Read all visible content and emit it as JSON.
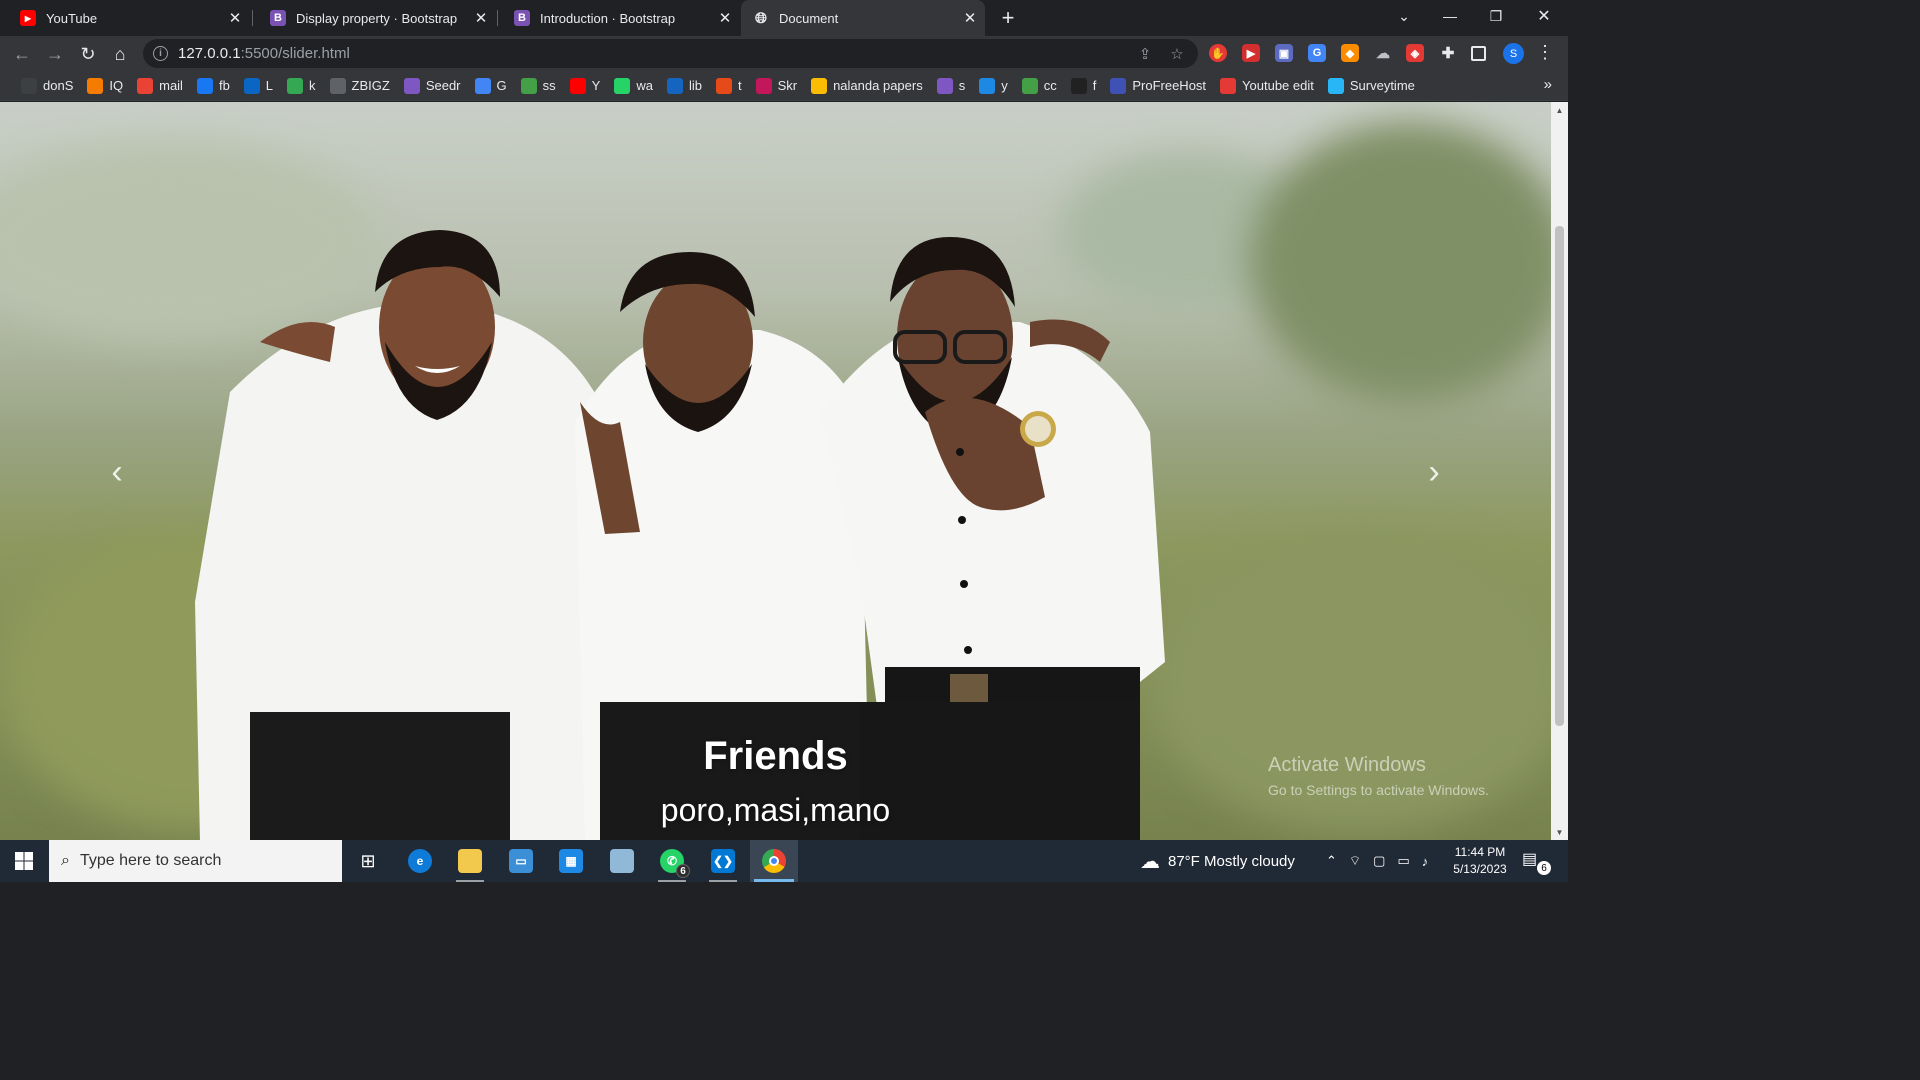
{
  "browser": {
    "tabs": [
      {
        "title": "YouTube",
        "favicon": "youtube-icon",
        "active": false
      },
      {
        "title": "Display property · Bootstrap",
        "favicon": "bootstrap-icon",
        "active": false
      },
      {
        "title": "Introduction · Bootstrap",
        "favicon": "bootstrap-icon",
        "active": false
      },
      {
        "title": "Document",
        "favicon": "globe-icon",
        "active": true
      }
    ],
    "url_host": "127.0.0.1",
    "url_rest": ":5500/slider.html",
    "profile_initial": "S",
    "bookmarks": [
      {
        "label": "donS",
        "icon": "dons-icon",
        "color": "#3c4043"
      },
      {
        "label": "IQ",
        "icon": "iq-icon",
        "color": "#f57c00"
      },
      {
        "label": "mail",
        "icon": "gmail-icon",
        "color": "#ea4335"
      },
      {
        "label": "fb",
        "icon": "facebook-icon",
        "color": "#1877f2"
      },
      {
        "label": "L",
        "icon": "linkedin-icon",
        "color": "#0a66c2"
      },
      {
        "label": "k",
        "icon": "k-icon",
        "color": "#34a853"
      },
      {
        "label": "ZBIGZ",
        "icon": "cloud-icon",
        "color": "#5f6368"
      },
      {
        "label": "Seedr",
        "icon": "seedr-icon",
        "color": "#7e57c2"
      },
      {
        "label": "G",
        "icon": "google-translate-icon",
        "color": "#4285f4"
      },
      {
        "label": "ss",
        "icon": "download-icon",
        "color": "#43a047"
      },
      {
        "label": "Y",
        "icon": "youtube-icon",
        "color": "#ff0000"
      },
      {
        "label": "wa",
        "icon": "whatsapp-icon",
        "color": "#25d366"
      },
      {
        "label": "lib",
        "icon": "lib-icon",
        "color": "#1565c0"
      },
      {
        "label": "t",
        "icon": "t-icon",
        "color": "#e64a19"
      },
      {
        "label": "Skr",
        "icon": "skr-icon",
        "color": "#c2185b"
      },
      {
        "label": "nalanda papers",
        "icon": "google-drive-icon",
        "color": "#fbbc04"
      },
      {
        "label": "s",
        "icon": "s-icon",
        "color": "#7e57c2"
      },
      {
        "label": "y",
        "icon": "y-icon",
        "color": "#1e88e5"
      },
      {
        "label": "cc",
        "icon": "cc-icon",
        "color": "#43a047"
      },
      {
        "label": "f",
        "icon": "f-icon",
        "color": "#212121"
      },
      {
        "label": "ProFreeHost",
        "icon": "profreehost-icon",
        "color": "#3f51b5"
      },
      {
        "label": "Youtube edit",
        "icon": "youtube-edit-icon",
        "color": "#e53935"
      },
      {
        "label": "Surveytime",
        "icon": "surveytime-icon",
        "color": "#29b6f6"
      }
    ]
  },
  "page": {
    "caption_title": "Friends",
    "caption_subtitle": "poro,masi,mano",
    "watermark_line1": "Activate Windows",
    "watermark_line2": "Go to Settings to activate Windows."
  },
  "taskbar": {
    "search_placeholder": "Type here to search",
    "whatsapp_badge": "6",
    "weather": "87°F  Mostly cloudy",
    "time": "11:44 PM",
    "date": "5/13/2023",
    "notifications_count": "6"
  }
}
